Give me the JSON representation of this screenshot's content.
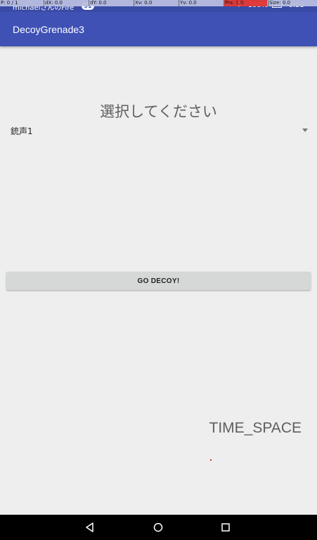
{
  "status_bar": {
    "title": "michaelさんのFire",
    "badge": "31",
    "battery": "100%",
    "time": "0:53"
  },
  "debug_overlay": {
    "pointer": "P: 0 / 1",
    "dx": "dX: 0.0",
    "dy": "dY: 0.0",
    "xv": "Xv: 0.0",
    "yv": "Yv: 0.0",
    "prs": "Prs: 1.0",
    "size": "Size: 0.0"
  },
  "app_bar": {
    "title": "DecoyGrenade3"
  },
  "main": {
    "prompt": "選択してください",
    "spinner_value": "銃声1",
    "go_button_label": "GO DECOY!",
    "time_space_label": "TIME_SPACE"
  },
  "colors": {
    "primary": "#3F51B5",
    "primary_dark": "#3A4BA6",
    "background": "#EEEEEE",
    "button": "#D6D7D7",
    "pointer_dot": "#D32F2F"
  },
  "icons": {
    "back": "back-triangle-icon",
    "home": "home-circle-icon",
    "recent": "recent-apps-square-icon",
    "wifi": "wifi-icon",
    "battery": "battery-icon",
    "dropdown": "dropdown-arrow-icon"
  }
}
